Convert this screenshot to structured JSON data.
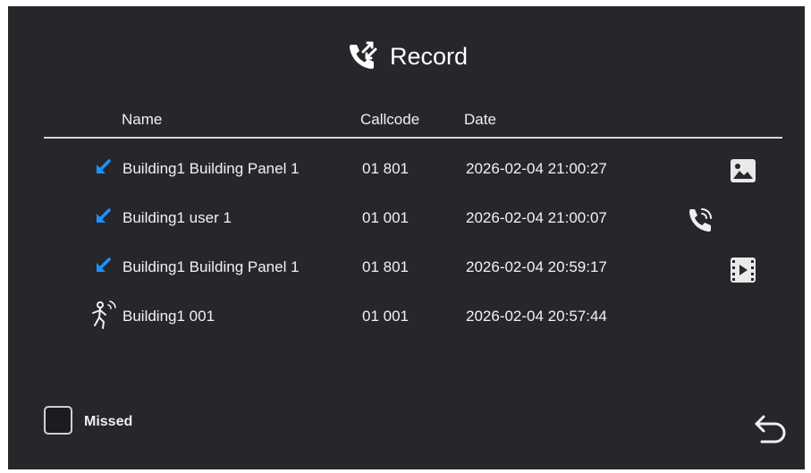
{
  "header": {
    "title": "Record",
    "icon": "call-record-icon"
  },
  "columns": {
    "name": "Name",
    "callcode": "Callcode",
    "date": "Date"
  },
  "records": [
    {
      "direction_icon": "incoming-call-arrow-icon",
      "name": "Building1 Building Panel 1",
      "callcode": "01 801",
      "date": "2026-02-04 21:00:27",
      "media_icon": "image-icon"
    },
    {
      "direction_icon": "incoming-call-arrow-icon",
      "name": "Building1 user 1",
      "callcode": "01 001",
      "date": "2026-02-04 21:00:07",
      "media_icon": "phone-call-icon"
    },
    {
      "direction_icon": "incoming-call-arrow-icon",
      "name": "Building1 Building Panel 1",
      "callcode": "01 801",
      "date": "2026-02-04 20:59:17",
      "media_icon": "video-icon"
    },
    {
      "direction_icon": "motion-detection-icon",
      "name": "Building1 001",
      "callcode": "01 001",
      "date": "2026-02-04 20:57:44",
      "media_icon": ""
    }
  ],
  "filter": {
    "missed_label": "Missed",
    "missed_checked": false
  },
  "footer": {
    "back_icon": "back-arrow-icon"
  },
  "colors": {
    "background": "#25272b",
    "accent": "#1e90ff",
    "text": "#ffffff",
    "divider": "#d8d8d8"
  }
}
